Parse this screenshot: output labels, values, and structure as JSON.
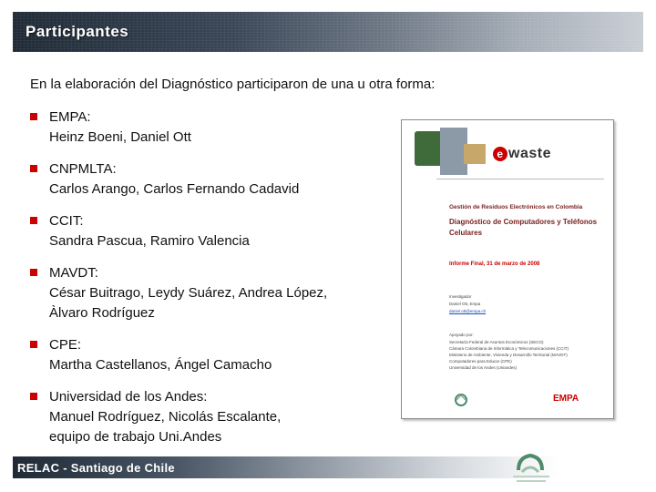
{
  "header": {
    "title": "Participantes"
  },
  "intro": "En la elaboración del Diagnóstico participaron de una u otra forma:",
  "participants": [
    {
      "org": "EMPA:",
      "lines": [
        "Heinz Boeni, Daniel Ott"
      ]
    },
    {
      "org": "CNPMLTA:",
      "lines": [
        "Carlos Arango, Carlos Fernando Cadavid"
      ]
    },
    {
      "org": "CCIT:",
      "lines": [
        "Sandra Pascua, Ramiro Valencia"
      ]
    },
    {
      "org": "MAVDT:",
      "lines": [
        "César Buitrago, Leydy Suárez, Andrea López,",
        "Àlvaro Rodríguez"
      ]
    },
    {
      "org": "CPE:",
      "lines": [
        "Martha Castellanos, Ángel Camacho"
      ]
    },
    {
      "org": "Universidad de los Andes:",
      "lines": [
        "Manuel Rodríguez, Nicolás Escalante,",
        "equipo de trabajo Uni.Andes"
      ]
    }
  ],
  "document": {
    "brand": "waste",
    "brand_letter": "e",
    "heading": "Gestión de Residuos Electrónicos en Colombia",
    "title": "Diagnóstico de Computadores y Teléfonos Celulares",
    "report_date": "Informe Final, 31 de marzo de 2008",
    "investigator_label": "Investigador",
    "investigator_name": "Daniel Ott, Empa",
    "investigator_email": "daniel.ott@empa.ch",
    "support_label": "Apoyado por:",
    "supporters": [
      "Secretaría Federal de Asuntos Económicos (SECO)",
      "Cámara Colombiana de Informática y Telecomunicaciones (CCIT)",
      "Ministerio de Ambiente, Vivienda y Desarrollo Territorial (MAVDT)",
      "Computadores para Educar (CPE)",
      "Universidad de los Andes (Uniandes)"
    ],
    "right_logo": "EMPA"
  },
  "footer": {
    "text": "RELAC -  Santiago de Chile"
  },
  "colors": {
    "bullet": "#cc0000",
    "header_dark": "#1f2a36",
    "accent_red": "#cc0000"
  }
}
